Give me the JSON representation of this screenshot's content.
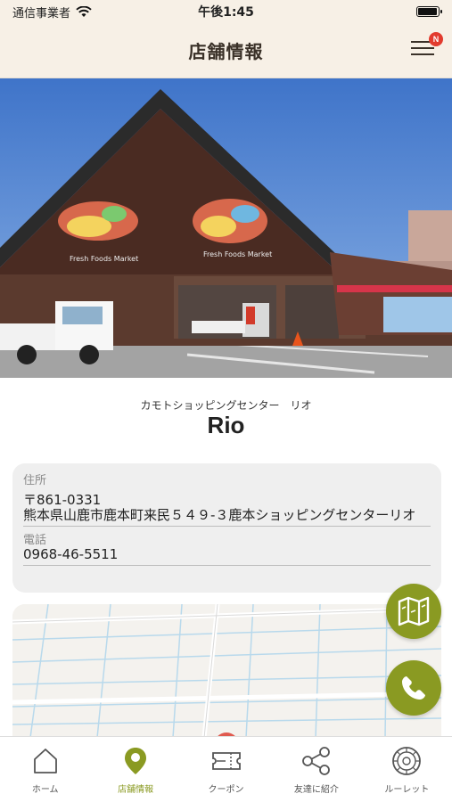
{
  "status_bar": {
    "carrier": "通信事業者",
    "time": "午後1:45",
    "battery_level": 0.95
  },
  "header": {
    "title": "店舗情報",
    "badge": "N"
  },
  "hero": {
    "sign_text": "Fresh Foods Market",
    "sign_text_2": "Fresh Foods Market"
  },
  "store": {
    "kana": "カモトショッピングセンター　リオ",
    "name": "Rio"
  },
  "info": {
    "address_label": "住所",
    "postal_code": "〒861-0331",
    "address": "熊本県山鹿市鹿本町来民５４９-３鹿本ショッピングセンターリオ",
    "phone_label": "電話",
    "phone": "0968-46-5511"
  },
  "icons": {
    "map": "map-icon",
    "phone": "phone-icon",
    "home": "home-icon",
    "pin": "location-pin-icon",
    "coupon": "coupon-icon",
    "share": "share-icon",
    "roulette": "roulette-icon"
  },
  "colors": {
    "accent": "#8a9a22",
    "header_bg": "#f7f0e6",
    "badge": "#e23b2e",
    "map_pin": "#e05a4f"
  },
  "tabs": [
    {
      "label": "ホーム",
      "active": false
    },
    {
      "label": "店舗情報",
      "active": true
    },
    {
      "label": "クーポン",
      "active": false
    },
    {
      "label": "友達に紹介",
      "active": false
    },
    {
      "label": "ルーレット",
      "active": false
    }
  ]
}
